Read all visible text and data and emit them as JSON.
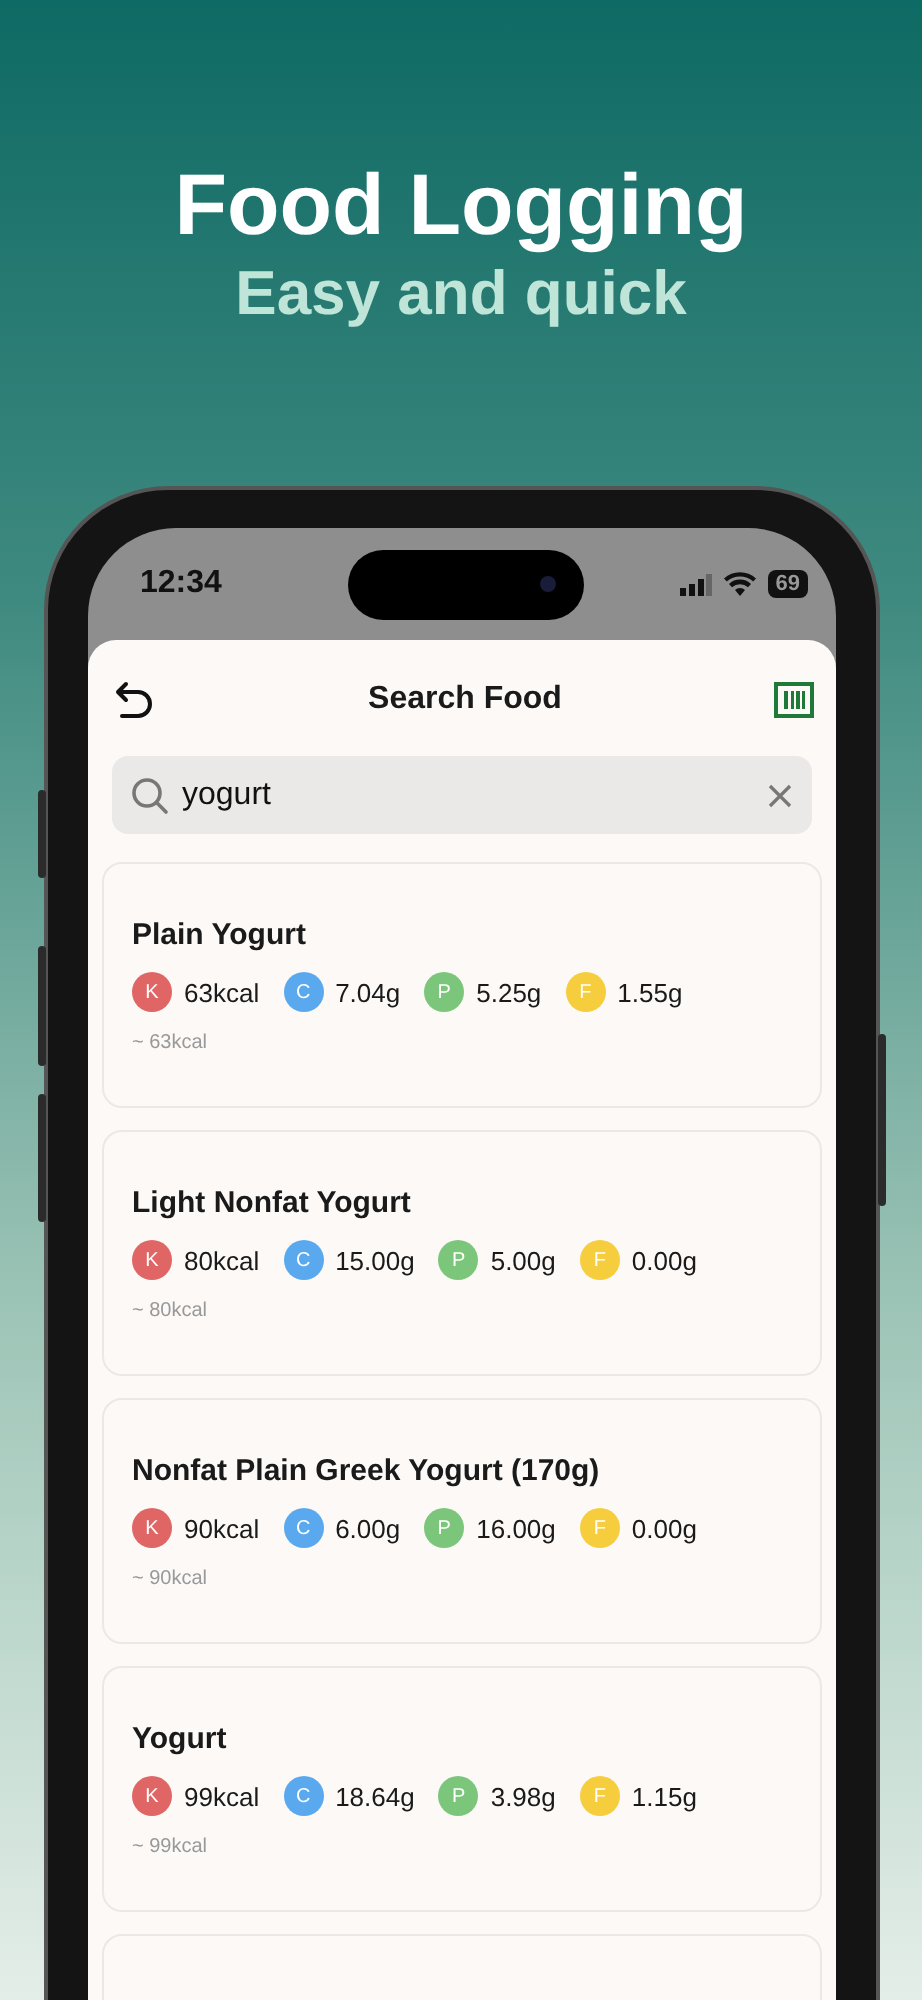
{
  "headline": {
    "title": "Food Logging",
    "subtitle": "Easy and quick"
  },
  "status_bar": {
    "time": "12:34",
    "battery": "69"
  },
  "header": {
    "title": "Search Food"
  },
  "search": {
    "value": "yogurt"
  },
  "results": [
    {
      "name": "Plain Yogurt",
      "nutrients": [
        {
          "kind": "kcal",
          "letter": "K",
          "value": "63kcal"
        },
        {
          "kind": "carbs",
          "letter": "C",
          "value": "7.04g"
        },
        {
          "kind": "protein",
          "letter": "P",
          "value": "5.25g"
        },
        {
          "kind": "fat",
          "letter": "F",
          "value": "1.55g"
        }
      ],
      "serving": "~ 63kcal"
    },
    {
      "name": "Light Nonfat Yogurt",
      "nutrients": [
        {
          "kind": "kcal",
          "letter": "K",
          "value": "80kcal"
        },
        {
          "kind": "carbs",
          "letter": "C",
          "value": "15.00g"
        },
        {
          "kind": "protein",
          "letter": "P",
          "value": "5.00g"
        },
        {
          "kind": "fat",
          "letter": "F",
          "value": "0.00g"
        }
      ],
      "serving": "~ 80kcal"
    },
    {
      "name": "Nonfat Plain Greek Yogurt (170g)",
      "nutrients": [
        {
          "kind": "kcal",
          "letter": "K",
          "value": "90kcal"
        },
        {
          "kind": "carbs",
          "letter": "C",
          "value": "6.00g"
        },
        {
          "kind": "protein",
          "letter": "P",
          "value": "16.00g"
        },
        {
          "kind": "fat",
          "letter": "F",
          "value": "0.00g"
        }
      ],
      "serving": "~ 90kcal"
    },
    {
      "name": "Yogurt",
      "nutrients": [
        {
          "kind": "kcal",
          "letter": "K",
          "value": "99kcal"
        },
        {
          "kind": "carbs",
          "letter": "C",
          "value": "18.64g"
        },
        {
          "kind": "protein",
          "letter": "P",
          "value": "3.98g"
        },
        {
          "kind": "fat",
          "letter": "F",
          "value": "1.15g"
        }
      ],
      "serving": "~ 99kcal"
    }
  ]
}
